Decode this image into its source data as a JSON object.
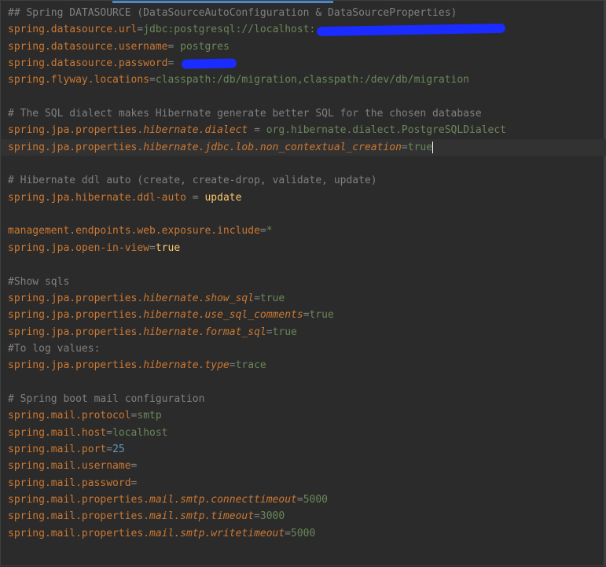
{
  "editor": {
    "lines": [
      {
        "type": "comment",
        "text": "## Spring DATASOURCE (DataSourceAutoConfiguration & DataSourceProperties)"
      },
      {
        "type": "kv",
        "key_plain": "spring.datasource.url",
        "sep": "=",
        "value": "jdbc:postgresql://localhost:",
        "redacted_suffix": true
      },
      {
        "type": "kv",
        "key_plain": "spring.datasource.username",
        "sep": "= ",
        "value": "postgres"
      },
      {
        "type": "kv",
        "key_plain": "spring.datasource.password",
        "sep": "= ",
        "value": "",
        "redacted_suffix": true
      },
      {
        "type": "kv",
        "key_plain": "spring.flyway.locations",
        "sep": "=",
        "value": "classpath:/db/migration,classpath:/dev/db/migration"
      },
      {
        "type": "blank"
      },
      {
        "type": "comment",
        "text": "# The SQL dialect makes Hibernate generate better SQL for the chosen database"
      },
      {
        "type": "kv",
        "key_plain": "spring.jpa.properties.",
        "key_italic": "hibernate.dialect",
        "sep": " = ",
        "value": "org.hibernate.dialect.PostgreSQLDialect"
      },
      {
        "type": "kv",
        "key_plain": "spring.jpa.properties.",
        "key_italic": "hibernate.jdbc.lob.non_contextual_creation",
        "sep": "=",
        "value": "true",
        "current": true
      },
      {
        "type": "blank"
      },
      {
        "type": "comment",
        "text": "# Hibernate ddl auto (create, create-drop, validate, update)"
      },
      {
        "type": "kv",
        "key_plain": "spring.jpa.hibernate.ddl-auto",
        "sep": " = ",
        "value": "update",
        "strong": true
      },
      {
        "type": "blank"
      },
      {
        "type": "kv",
        "key_plain": "management.endpoints.web.exposure.include",
        "sep": "=",
        "value": "*"
      },
      {
        "type": "kv",
        "key_plain": "spring.jpa.open-in-view",
        "sep": "=",
        "value": "true",
        "strong": true
      },
      {
        "type": "blank"
      },
      {
        "type": "comment",
        "text": "#Show sqls"
      },
      {
        "type": "kv",
        "key_plain": "spring.jpa.properties.",
        "key_italic": "hibernate.show_sql",
        "sep": "=",
        "value": "true"
      },
      {
        "type": "kv",
        "key_plain": "spring.jpa.properties.",
        "key_italic": "hibernate.use_sql_comments",
        "sep": "=",
        "value": "true"
      },
      {
        "type": "kv",
        "key_plain": "spring.jpa.properties.",
        "key_italic": "hibernate.format_sql",
        "sep": "=",
        "value": "true"
      },
      {
        "type": "comment",
        "text": "#To log values:"
      },
      {
        "type": "kv",
        "key_plain": "spring.jpa.properties.",
        "key_italic": "hibernate.type",
        "sep": "=",
        "value": "trace"
      },
      {
        "type": "blank"
      },
      {
        "type": "comment",
        "text": "# Spring boot mail configuration"
      },
      {
        "type": "kv",
        "key_plain": "spring.mail.protocol",
        "sep": "=",
        "value": "smtp"
      },
      {
        "type": "kv",
        "key_plain": "spring.mail.host",
        "sep": "=",
        "value": "localhost"
      },
      {
        "type": "kv",
        "key_plain": "spring.mail.port",
        "sep": "=",
        "value": "25",
        "numeric": true
      },
      {
        "type": "kv",
        "key_plain": "spring.mail.username",
        "sep": "=",
        "value": ""
      },
      {
        "type": "kv",
        "key_plain": "spring.mail.password",
        "sep": "=",
        "value": ""
      },
      {
        "type": "kv",
        "key_plain": "spring.mail.properties.",
        "key_italic": "mail.smtp.connecttimeout",
        "sep": "=",
        "value": "5000"
      },
      {
        "type": "kv",
        "key_plain": "spring.mail.properties.",
        "key_italic": "mail.smtp.timeout",
        "sep": "=",
        "value": "3000"
      },
      {
        "type": "kv",
        "key_plain": "spring.mail.properties.",
        "key_italic": "mail.smtp.writetimeout",
        "sep": "=",
        "value": "5000"
      }
    ]
  },
  "colors": {
    "background": "#2b2b2b",
    "key": "#cc7832",
    "comment": "#808080",
    "value": "#6a8759",
    "value_strong": "#ffc66d",
    "number": "#6897bb",
    "redaction": "#1a2cff",
    "tab_indicator": "#4a88c7"
  }
}
